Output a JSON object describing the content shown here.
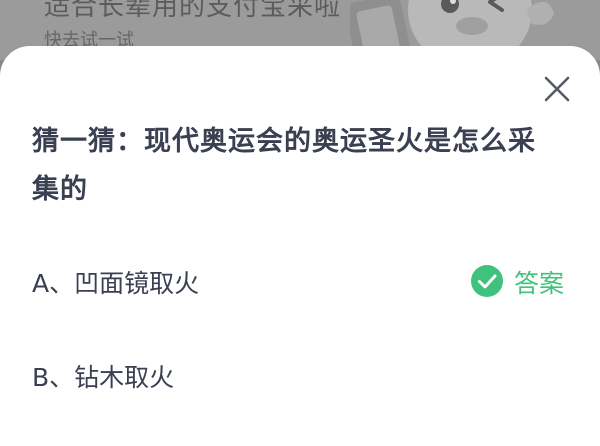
{
  "backdrop": {
    "title": "适合长辈用的支付宝采啦",
    "subtitle": "快去试一试"
  },
  "modal": {
    "question": "猜一猜：现代奥运会的奥运圣火是怎么采集的",
    "options": [
      {
        "label": "A、凹面镜取火",
        "is_answer": true
      },
      {
        "label": "B、钻木取火",
        "is_answer": false
      }
    ],
    "answer_label": "答案",
    "close_icon": "close-icon"
  },
  "colors": {
    "answer_green": "#3fc27b",
    "question_text": "#3a3f52",
    "overlay": "#8a8a8a"
  }
}
